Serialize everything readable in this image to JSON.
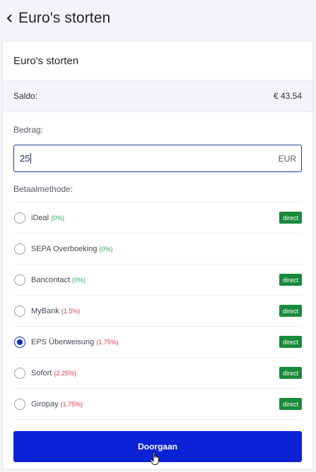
{
  "header": {
    "title": "Euro's storten",
    "back_icon": "chevron-left-icon"
  },
  "card": {
    "title": "Euro's storten",
    "saldo_label": "Saldo:",
    "saldo_value": "€ 43.54",
    "amount_label": "Bedrag:",
    "amount_value": "25",
    "currency": "EUR",
    "method_label": "Betaalmethode:",
    "methods": [
      {
        "name": "iDeal",
        "fee": "(0%)",
        "fee_type": "free",
        "badge": "direct",
        "selected": false
      },
      {
        "name": "SEPA Overboeking",
        "fee": "(0%)",
        "fee_type": "free",
        "badge": "",
        "selected": false
      },
      {
        "name": "Bancontact",
        "fee": "(0%)",
        "fee_type": "free",
        "badge": "direct",
        "selected": false
      },
      {
        "name": "MyBank",
        "fee": "(1.5%)",
        "fee_type": "paid",
        "badge": "direct",
        "selected": false
      },
      {
        "name": "EPS Überweisung",
        "fee": "(1.75%)",
        "fee_type": "paid",
        "badge": "direct",
        "selected": true
      },
      {
        "name": "Sofort",
        "fee": "(2.25%)",
        "fee_type": "paid",
        "badge": "direct",
        "selected": false
      },
      {
        "name": "Giropay",
        "fee": "(1.75%)",
        "fee_type": "paid",
        "badge": "direct",
        "selected": false
      }
    ],
    "submit_label": "Doorgaan"
  },
  "colors": {
    "accent": "#0c22d6",
    "badge": "#1a8a3c",
    "fee_free": "#2fa84f",
    "fee_paid": "#d73a49"
  }
}
